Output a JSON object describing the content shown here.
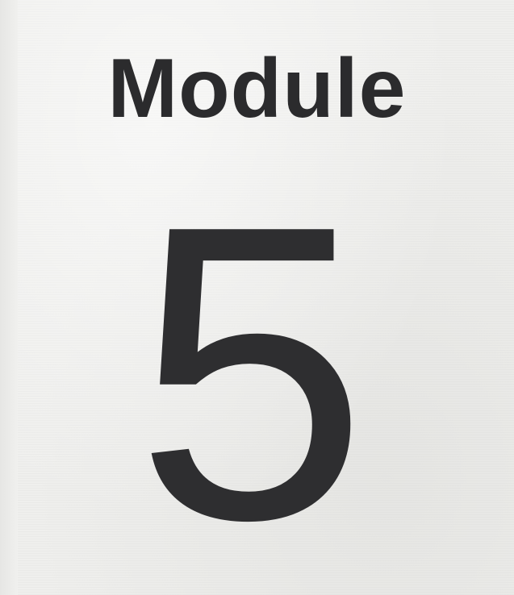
{
  "page": {
    "heading": "Module",
    "number": "5"
  },
  "colors": {
    "background": "#efefed",
    "text": "#2b2b2d"
  }
}
